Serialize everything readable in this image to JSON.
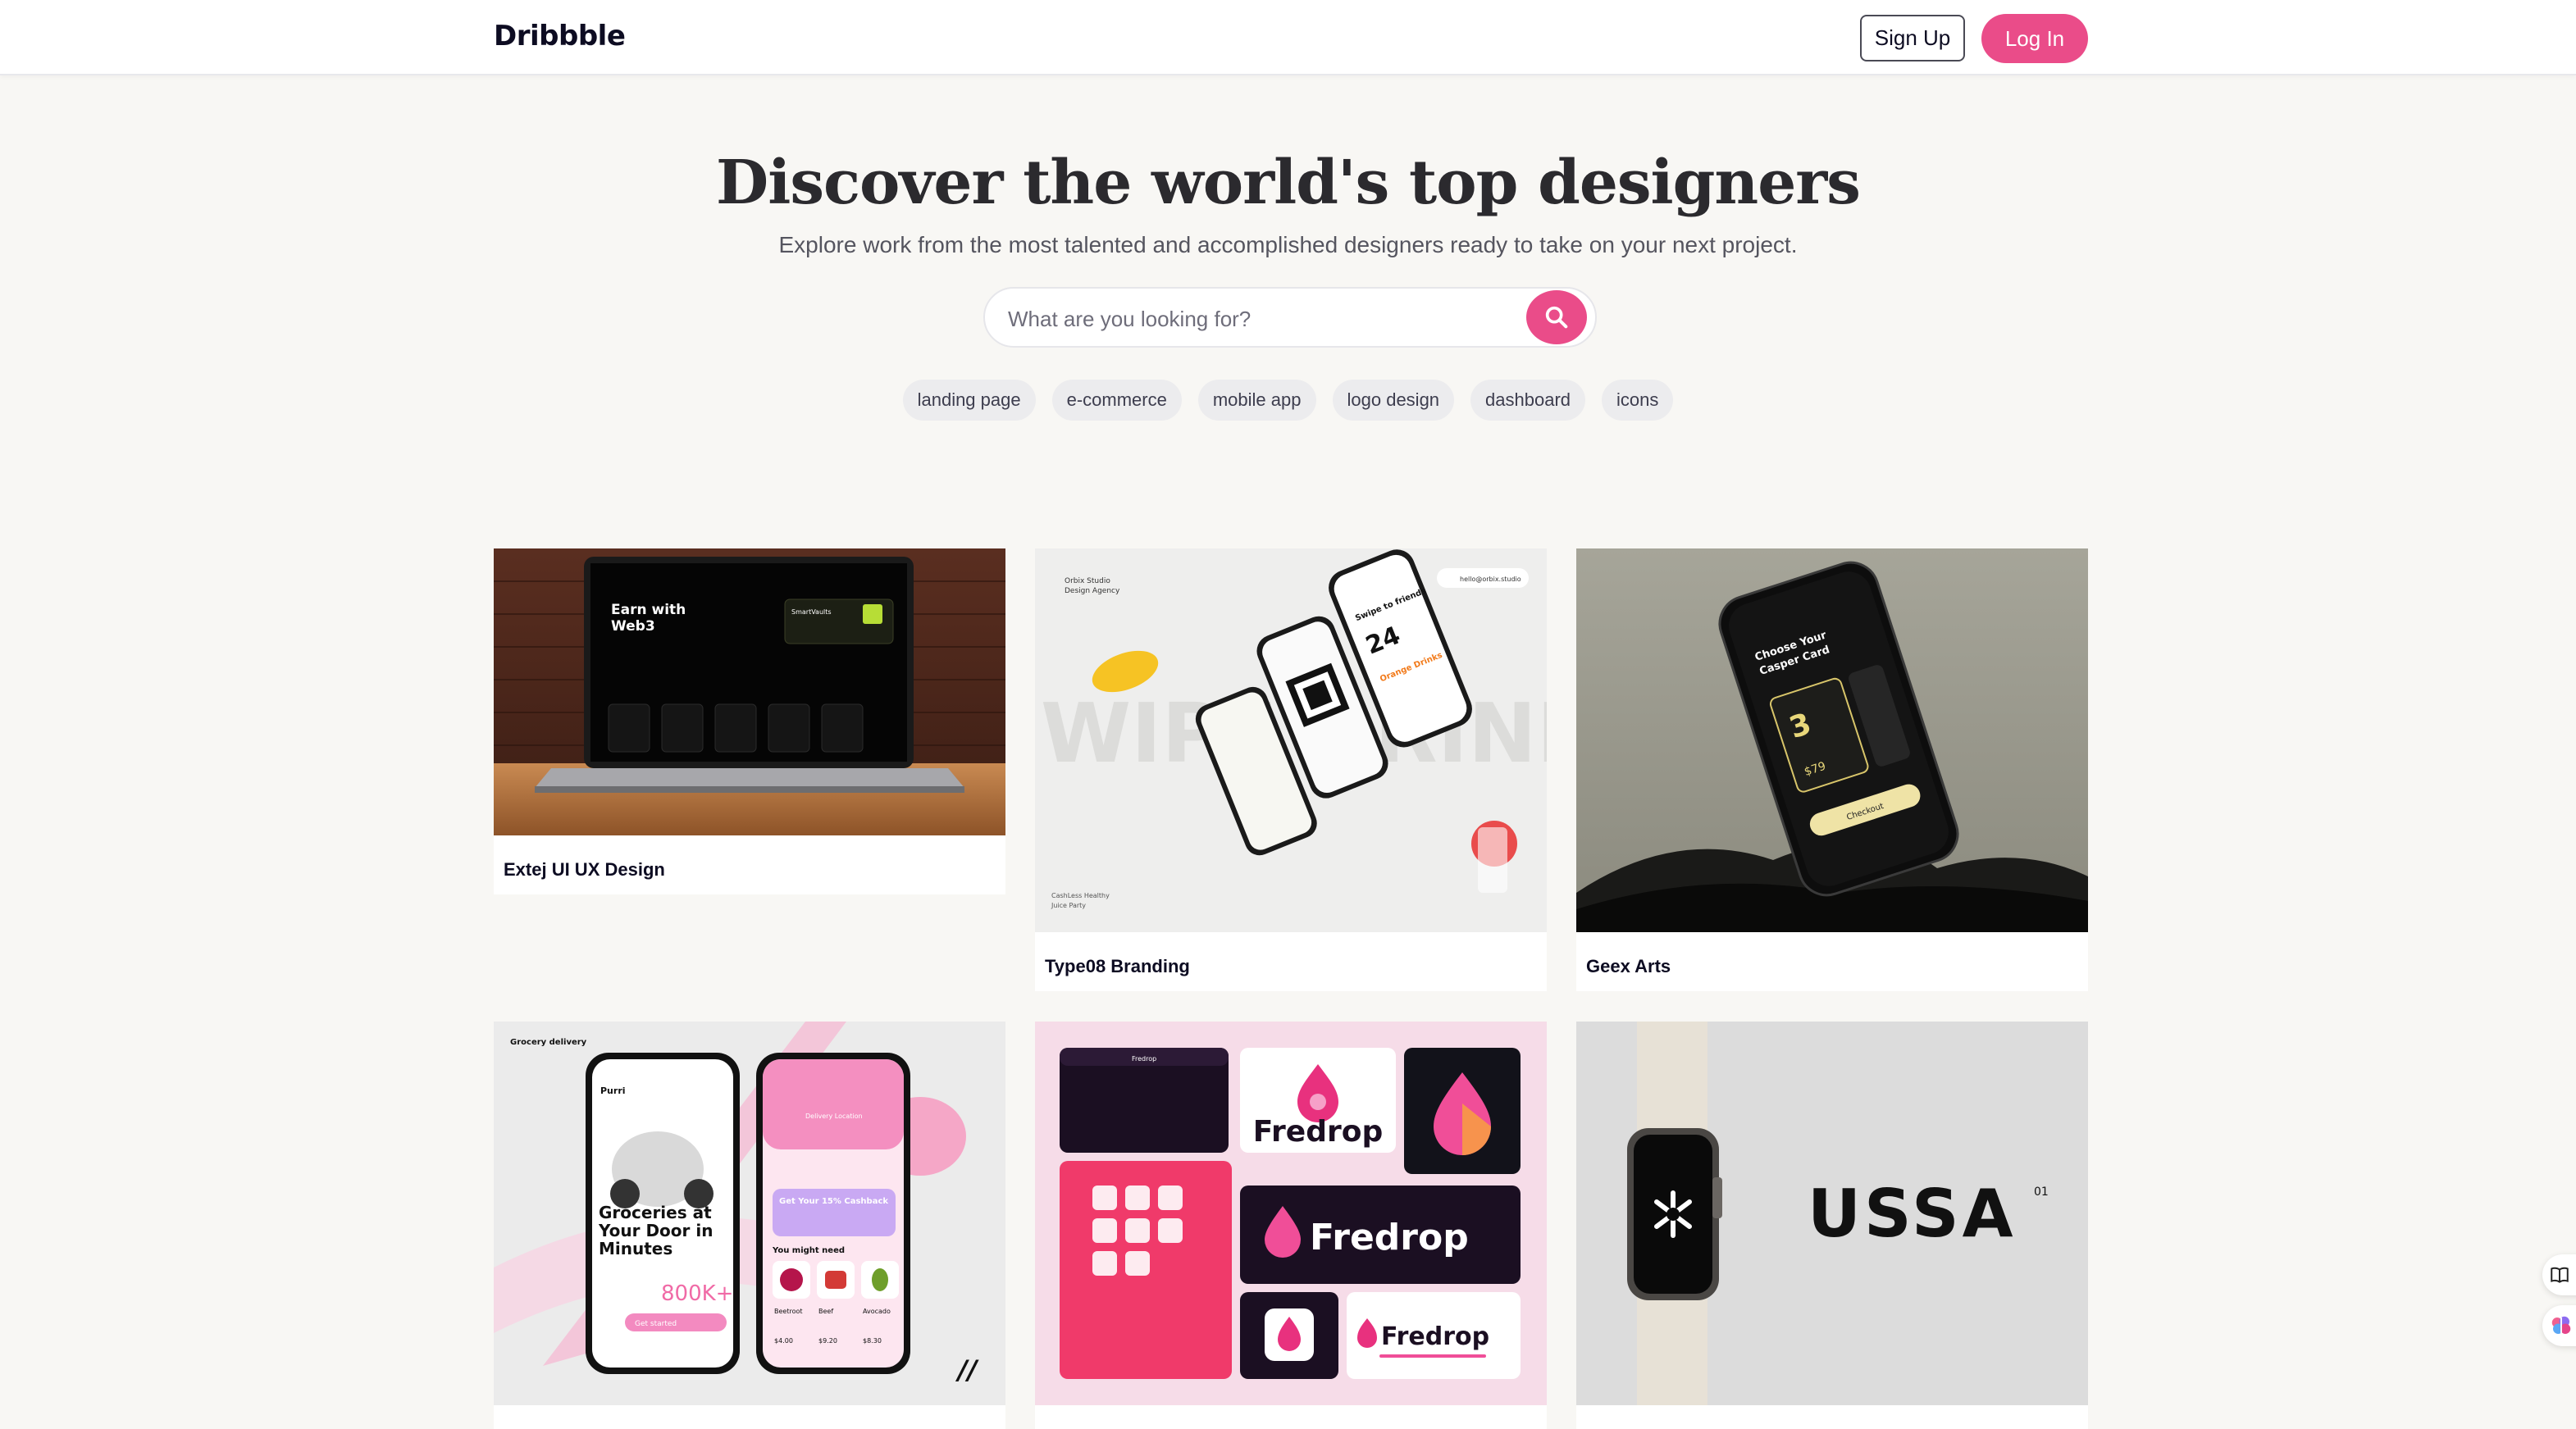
{
  "header": {
    "logo": "Dribbble",
    "signup_label": "Sign Up",
    "login_label": "Log In"
  },
  "hero": {
    "title": "Discover the world's top designers",
    "subtitle": "Explore work from the most talented and accomplished designers ready to take on your next project."
  },
  "search": {
    "placeholder": "What are you looking for?"
  },
  "tags": [
    "landing page",
    "e-commerce",
    "mobile app",
    "logo design",
    "dashboard",
    "icons"
  ],
  "cards": [
    {
      "title": "Extej UI UX Design",
      "laptop": {
        "heading_1": "Earn with",
        "heading_2": "Web3",
        "wallet": "SmartVaults"
      }
    },
    {
      "title": "Type08 Branding",
      "phones": {
        "studio": "Orbix Studio",
        "agency": "Design Agency",
        "email": "hello@orbix.studio",
        "swipe": "Swipe to friends",
        "number": "24",
        "drink": "Orange Drinks",
        "brand_1": "CashLess Healthy",
        "brand_2": "Juice Party",
        "bg_word": "SWIPE DRINK"
      }
    },
    {
      "title": "Geex Arts",
      "phone": {
        "choose": "Choose Your",
        "card_name": "Casper Card",
        "price": "$79",
        "button": "Checkout"
      }
    },
    {
      "title": "",
      "grocery": {
        "label": "Grocery delivery",
        "brand": "Purri",
        "headline": "Groceries at Your Door in Minutes",
        "stat": "800K+",
        "get_started": "Get started",
        "location": "Delivery Location",
        "promo": "Get Your 15% Cashback",
        "might_need": "You might need",
        "item_1": "Beetroot",
        "item_2": "Beef",
        "item_3": "Avocado",
        "price_1": "$4.00",
        "price_2": "$9.20",
        "price_3": "$8.30",
        "mark": "//"
      }
    },
    {
      "title": "",
      "fredrop": {
        "name": "Fredrop",
        "tab": "Fredrop"
      }
    },
    {
      "title": "",
      "ussa": {
        "word": "USSA",
        "number": "01"
      }
    }
  ],
  "colors": {
    "accent": "#ea4c89",
    "background": "#f8f7f4",
    "text": "#0d0c22"
  },
  "icons": {
    "search": "search-icon",
    "side_1": "book-icon",
    "side_2": "brain-icon"
  }
}
